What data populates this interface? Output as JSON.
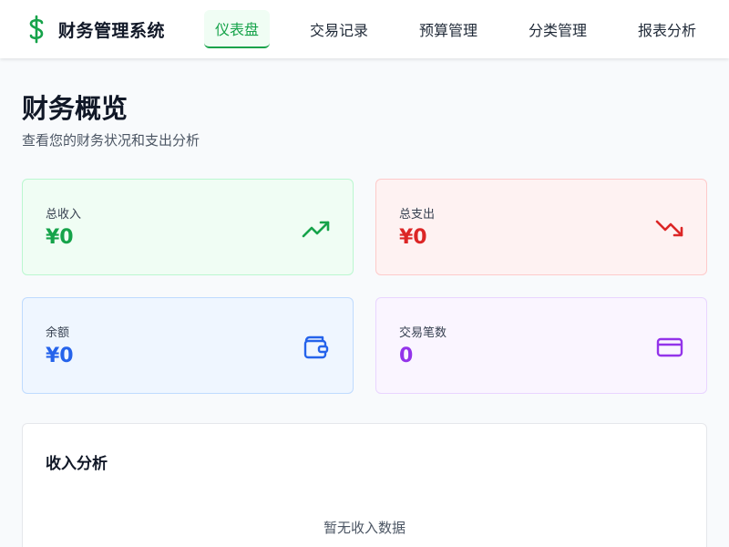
{
  "app": {
    "title": "财务管理系统",
    "brand_icon": "dollar-icon",
    "brand_color": "#16a34a"
  },
  "nav": {
    "tabs": [
      {
        "label": "仪表盘",
        "active": true
      },
      {
        "label": "交易记录",
        "active": false
      },
      {
        "label": "预算管理",
        "active": false
      },
      {
        "label": "分类管理",
        "active": false
      },
      {
        "label": "报表分析",
        "active": false
      }
    ]
  },
  "page": {
    "title": "财务概览",
    "subtitle": "查看您的财务状况和支出分析"
  },
  "stats": {
    "income": {
      "label": "总收入",
      "value": "¥0",
      "icon": "trending-up-icon",
      "color": "#16a34a"
    },
    "expense": {
      "label": "总支出",
      "value": "¥0",
      "icon": "trending-down-icon",
      "color": "#dc2626"
    },
    "balance": {
      "label": "余额",
      "value": "¥0",
      "icon": "wallet-icon",
      "color": "#2563eb"
    },
    "count": {
      "label": "交易笔数",
      "value": "0",
      "icon": "credit-card-icon",
      "color": "#9333ea"
    }
  },
  "analysis": {
    "title": "收入分析",
    "empty_text": "暂无收入数据"
  }
}
